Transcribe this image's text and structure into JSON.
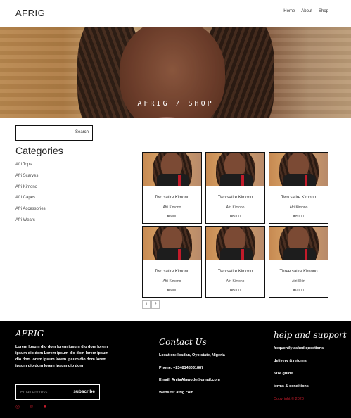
{
  "header": {
    "logo": "AFRIG",
    "nav": [
      "Home",
      "About",
      "Shop"
    ]
  },
  "hero": {
    "title": "AFRIG / SHOP"
  },
  "search": {
    "placeholder": "",
    "button_label": "Search"
  },
  "categories": {
    "title": "Categories",
    "items": [
      "Afri Tops",
      "Afri Scarves",
      "Afri Kimono",
      "Afri Capes",
      "Afri Accessories",
      "Afri Wears"
    ]
  },
  "products": [
    {
      "name": "Two satire Kimono",
      "category": "Afri Kimono",
      "price": "₦5000"
    },
    {
      "name": "Two satire Kimono",
      "category": "Afri Kimono",
      "price": "₦5000"
    },
    {
      "name": "Two satire Kimono",
      "category": "Afri Kimono",
      "price": "₦5000"
    },
    {
      "name": "Two satire Kimono",
      "category": "Afri Kimono",
      "price": "₦5000"
    },
    {
      "name": "Two satire Kimono",
      "category": "Afri Kimono",
      "price": "₦5000"
    },
    {
      "name": "Three satire Kimono",
      "category": "Afri Skirt",
      "price": "₦2000"
    }
  ],
  "pagination": [
    "1",
    "2"
  ],
  "footer": {
    "brand": "AFRIG",
    "about": "Lorem Ipsum dio dom lorem ipsum dio dom lorem ipsum dio dom Lorem ipsum dio dom lorem ipsum dio dom lorem ipsum lorem ipsum dio dom lorem ipsum dio dom lorem ipsum dio dom",
    "subscribe": {
      "placeholder": "Email Address",
      "button_label": "subscribe"
    },
    "social_icons": [
      "instagram-icon",
      "pinterest-icon",
      "facebook-icon"
    ],
    "contact": {
      "title": "Contact Us",
      "location": "Location: Ibadan, Oyo state, Nigeria",
      "phone": "Phone: +2348148031887",
      "email": "Email: AnitaAlawode@gmail.com",
      "website": "Website: afrig.com"
    },
    "help": {
      "title": "help and support",
      "links": [
        "frequently asked questions",
        "delivery & returns",
        "Size guide",
        "terms & conditions"
      ],
      "copyright": "Copyright © 2020"
    }
  },
  "colors": {
    "accent": "#c21b2a",
    "footer_bg": "#000000"
  }
}
